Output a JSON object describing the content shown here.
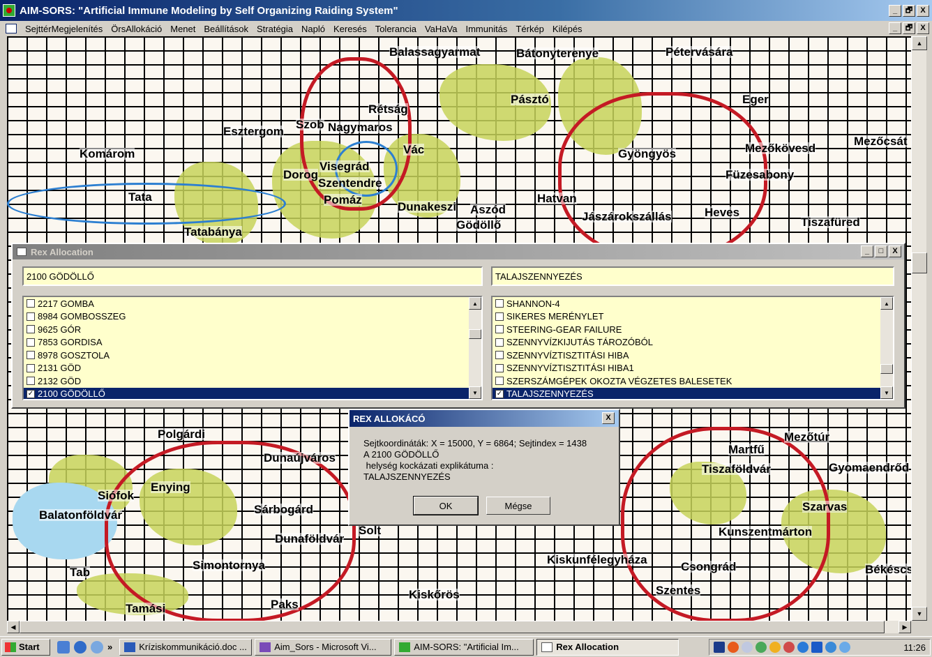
{
  "app": {
    "title": "AIM-SORS: \"Artificial Immune Modeling by Self Organizing Raiding System\""
  },
  "menu": [
    "SejttérMegjelenítés",
    "ÖrsAllokáció",
    "Menet",
    "Beállítások",
    "Stratégia",
    "Napló",
    "Keresés",
    "Tolerancia",
    "VaHaVa",
    "Immunitás",
    "Térkép",
    "Kilépés"
  ],
  "map_labels": [
    "Balassagyarmat",
    "Bátonyterenye",
    "Pétervására",
    "Eger",
    "Esztergom",
    "Komárom",
    "Vác",
    "Gyöngyös",
    "Szob",
    "Nagymaros",
    "Visegrád",
    "Szentendre",
    "Dorog",
    "Tata",
    "Tatabánya",
    "Pomáz",
    "Dunakeszi",
    "Aszód",
    "Gödöllő",
    "Hatvan",
    "Jászárokszállás",
    "Heves",
    "Mezőkövesd",
    "Füzesabony",
    "Tiszafüred",
    "Mezőcsát",
    "Rétság",
    "Pásztó",
    "Polgárdi",
    "Dunaújváros",
    "Enying",
    "Siófok",
    "Balatonföldvár",
    "Sárbogárd",
    "Dunaföldvár",
    "Solt",
    "Simontornya",
    "Paks",
    "Kiskunfélegyháza",
    "Csongrád",
    "Szentes",
    "Szarvas",
    "Kunszentmárton",
    "Tiszaföldvár",
    "Martfű",
    "Mezőtúr",
    "Gyomaendrőd",
    "Kiskőrös",
    "Tamási",
    "Tab",
    "Békéscsaba"
  ],
  "rex_window": {
    "title": "Rex Allocation",
    "location_field": "2100 GÖDÖLLŐ",
    "risk_field": "TALAJSZENNYEZÉS",
    "locations": [
      {
        "label": "2217 GOMBA",
        "checked": false,
        "selected": false
      },
      {
        "label": "8984 GOMBOSSZEG",
        "checked": false,
        "selected": false
      },
      {
        "label": "9625 GÓR",
        "checked": false,
        "selected": false
      },
      {
        "label": "7853 GORDISA",
        "checked": false,
        "selected": false
      },
      {
        "label": "8978 GOSZTOLA",
        "checked": false,
        "selected": false
      },
      {
        "label": "2131 GÖD",
        "checked": false,
        "selected": false
      },
      {
        "label": "2132 GÖD",
        "checked": false,
        "selected": false
      },
      {
        "label": "2100 GÖDÖLLŐ",
        "checked": true,
        "selected": true
      }
    ],
    "risks": [
      {
        "label": "SHANNON-4",
        "checked": false,
        "selected": false
      },
      {
        "label": "SIKERES MERÉNYLET",
        "checked": false,
        "selected": false
      },
      {
        "label": "STEERING-GEAR FAILURE",
        "checked": false,
        "selected": false
      },
      {
        "label": "SZENNYVÍZKIJUTÁS TÁROZÓBÓL",
        "checked": false,
        "selected": false
      },
      {
        "label": "SZENNYVÍZTISZTITÁSI HIBA",
        "checked": false,
        "selected": false
      },
      {
        "label": "SZENNYVÍZTISZTITÁSI HIBA1",
        "checked": false,
        "selected": false
      },
      {
        "label": "SZERSZÁMGÉPEK OKOZTA VÉGZETES BALESETEK",
        "checked": false,
        "selected": false
      },
      {
        "label": "TALAJSZENNYEZÉS",
        "checked": true,
        "selected": true
      }
    ]
  },
  "dialog": {
    "title": "REX ALLOKÁCÓ",
    "line1": "Sejtkoordináták: X = 15000, Y = 6864; Sejtindex = 1438",
    "line2": "A 2100 GÖDÖLLŐ",
    "line3": " helység kockázati explikátuma :",
    "line4": "TALAJSZENNYEZÉS",
    "ok_label": "OK",
    "cancel_label": "Mégse"
  },
  "taskbar": {
    "start_label": "Start",
    "overflow_label": "»",
    "tasks": [
      {
        "label": "Kríziskommunikáció.doc ...",
        "active": false
      },
      {
        "label": "Aim_Sors - Microsoft Vi...",
        "active": false
      },
      {
        "label": "AIM-SORS: \"Artificial Im...",
        "active": false
      },
      {
        "label": "Rex Allocation",
        "active": true
      }
    ],
    "clock": "11:26"
  },
  "window_buttons": {
    "minimize": "_",
    "restore": "🗗",
    "maximize": "□",
    "close": "X"
  },
  "colors": {
    "titlebar": "#0a246a",
    "list_bg": "#ffffcc",
    "selection": "#0a246a",
    "map_green": "#c7d35a",
    "road_red": "#c41a24",
    "river_blue": "#2c7fd1"
  }
}
